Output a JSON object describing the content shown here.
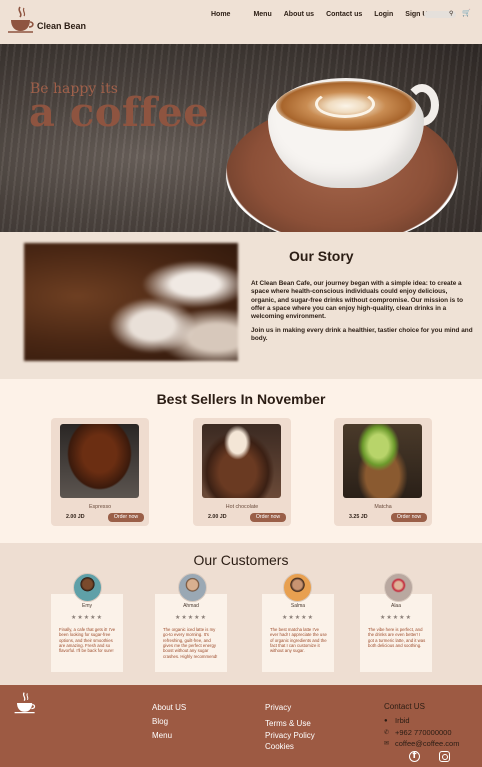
{
  "brand": {
    "name": "Clean Bean"
  },
  "nav": {
    "items": [
      "Home",
      "Menu",
      "About us",
      "Contact us",
      "Login",
      "Sign Up"
    ],
    "search_icon": "search-icon",
    "cart_icon": "cart-icon"
  },
  "hero": {
    "tagline": "Be happy its",
    "headline": "a coffee"
  },
  "story": {
    "title": "Our Story",
    "paragraph1": "At Clean Bean Cafe, our journey began with a simple idea: to create a space where health-conscious individuals could enjoy delicious, organic, and sugar-free drinks without compromise. Our mission is to offer a space where you can enjoy high-quality, clean drinks in a welcoming environment.",
    "paragraph2": "Join us in making every drink a healthier, tastier choice for you mind and body."
  },
  "best_sellers": {
    "title": "Best Sellers In November",
    "products": [
      {
        "name": "Espresso",
        "price": "2.00 JD",
        "button": "Order now"
      },
      {
        "name": "Hot chocolate",
        "price": "2.00 JD",
        "button": "Order now"
      },
      {
        "name": "Matcha",
        "price": "3.25 JD",
        "button": "Order now"
      }
    ]
  },
  "customers": {
    "title": "Our Customers",
    "reviews": [
      {
        "name": "Emy",
        "stars": "★★★★★",
        "text": "Finally, a cafe that gets it! I've been looking for sugar-free options, and their smoothies are amazing. Fresh and so flavorful. I'll be back for sure!"
      },
      {
        "name": "Ahmad",
        "stars": "★★★★★",
        "text": "The organic iced latte is my go-to every morning. It's refreshing, guilt-free, and gives me the perfect energy boost without any sugar crashes. Highly recommend!"
      },
      {
        "name": "Salma",
        "stars": "★★★★★",
        "text": "The best matcha latte I've ever had! I appreciate the use of organic ingredients and the fact that I can customize it without any sugar."
      },
      {
        "name": "Alaa",
        "stars": "★★★★★",
        "text": "The vibe here is perfect, and the drinks are even better! I got a turmeric latte, and it was both delicious and soothing."
      }
    ]
  },
  "footer": {
    "col1": [
      "About US",
      "Blog",
      "Menu"
    ],
    "col2": [
      "Privacy",
      "Terms & Use",
      "Privacy Policy",
      "Cookies"
    ],
    "contact_title": "Contact US",
    "location": "Irbid",
    "phone": "+962 770000000",
    "email": "coffee@coffee.com"
  }
}
